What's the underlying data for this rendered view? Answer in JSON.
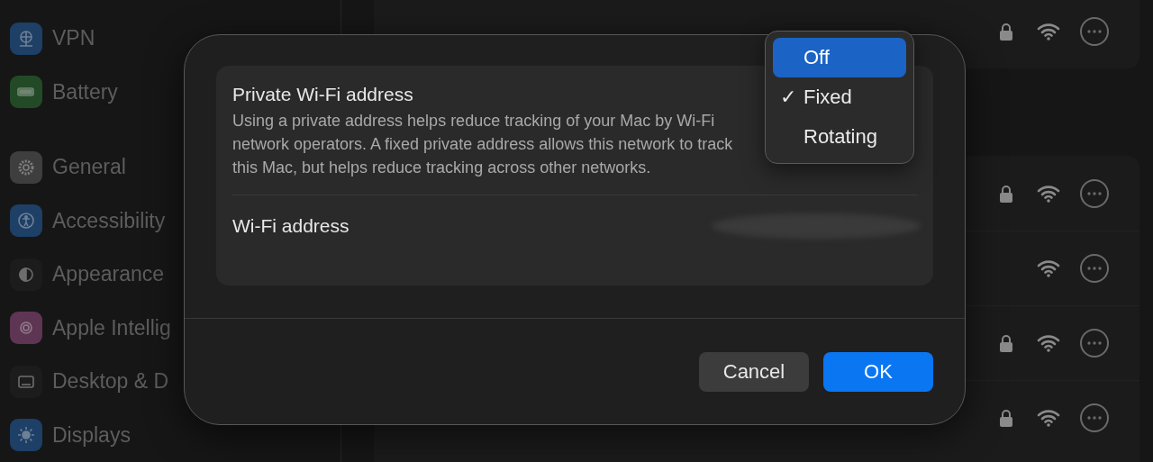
{
  "sidebar": {
    "items": [
      {
        "label": "VPN",
        "kind": "globe",
        "color": "#1e3f66",
        "group_start": false
      },
      {
        "label": "Battery",
        "kind": "battery",
        "color": "#224a26",
        "group_start": false
      },
      {
        "label": "General",
        "kind": "gear",
        "color": "#3e3e3e",
        "group_start": true
      },
      {
        "label": "Accessibility",
        "kind": "person",
        "color": "#1e3f66",
        "group_start": false
      },
      {
        "label": "Appearance",
        "kind": "contrast",
        "color": "#1c1c1c",
        "group_start": false
      },
      {
        "label": "Apple Intellig",
        "kind": "flower",
        "color": "#5e3553",
        "group_start": false
      },
      {
        "label": "Desktop & D",
        "kind": "dock",
        "color": "#1c1c1c",
        "group_start": false
      },
      {
        "label": "Displays",
        "kind": "sun",
        "color": "#1e3f66",
        "group_start": false
      }
    ]
  },
  "networks": [
    {
      "locked": true
    },
    {
      "locked": true
    },
    {
      "locked": false
    },
    {
      "locked": true
    },
    {
      "locked": true
    }
  ],
  "dialog": {
    "title": "Private Wi-Fi address",
    "description": "Using a private address helps reduce tracking of your Mac by Wi-Fi network operators. A fixed private address allows this network to track this Mac, but helps reduce tracking across other networks.",
    "address_label": "Wi-Fi address",
    "menu": [
      {
        "label": "Off",
        "selected": true,
        "checked": false
      },
      {
        "label": "Fixed",
        "selected": false,
        "checked": true
      },
      {
        "label": "Rotating",
        "selected": false,
        "checked": false
      }
    ],
    "check_mark": "✓",
    "buttons": [
      {
        "label": "Cancel",
        "kind": "secondary"
      },
      {
        "label": "OK",
        "kind": "primary"
      }
    ]
  }
}
